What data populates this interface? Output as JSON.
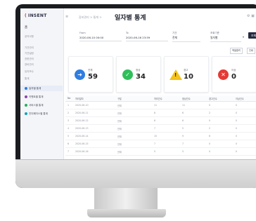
{
  "brand": {
    "mark": "(",
    "name": "INSENT"
  },
  "sidebar": {
    "home": "홈",
    "items": [
      "공지사항",
      "기관관리",
      "기관설정",
      "권한관리",
      "장비관리",
      "유지보수",
      "통계"
    ],
    "subitems": [
      {
        "label": "일자별 통계",
        "color": "#2f7de1",
        "active": true
      },
      {
        "label": "이벤트별 통계",
        "color": "#8e44ad",
        "active": false
      },
      {
        "label": "서비스별 통계",
        "color": "#27ae60",
        "active": false
      },
      {
        "label": "인더페이스별 통계",
        "color": "#16a2b8",
        "active": false
      }
    ]
  },
  "header": {
    "breadcrumb": "장비관리 > 통계 >",
    "title": "일자별 통계",
    "right_icons": "⚙ ▣"
  },
  "filter": {
    "from_label": "From",
    "from_value": "2020-06-10 00:00",
    "to_label": "To",
    "to_value": "2020-06-16 23:59",
    "agency_label": "기관",
    "agency_value": "전체",
    "type_label": "조회기준",
    "type_value": "일자별",
    "search_label": "조회"
  },
  "actions": {
    "excel": "엑셀출력",
    "print": "인쇄"
  },
  "colors": {
    "blue": "#2f7de1",
    "green": "#2fbf5a",
    "yellow": "#f4c21a",
    "red": "#e53935",
    "dark": "#262a40"
  },
  "stats": [
    {
      "label": "전체",
      "value": "59",
      "icon": "arrow-right-icon"
    },
    {
      "label": "정상",
      "value": "34",
      "icon": "check-icon"
    },
    {
      "label": "경고",
      "value": "10",
      "icon": "warning-icon"
    },
    {
      "label": "이상",
      "value": "0",
      "icon": "close-icon"
    }
  ],
  "table": {
    "columns": [
      "No",
      "처리일자",
      "구분",
      "처리건수",
      "정상건수",
      "경고건수",
      "이상건수"
    ],
    "rows": [
      [
        "1",
        "2020-06-10",
        "전체",
        "11",
        "11",
        "0",
        "0"
      ],
      [
        "2",
        "2020-06-11",
        "전체",
        "8",
        "6",
        "2",
        "0"
      ],
      [
        "3",
        "2020-06-12",
        "전체",
        "6",
        "6",
        "0",
        "0"
      ],
      [
        "4",
        "2020-06-13",
        "전체",
        "7",
        "5",
        "2",
        "0"
      ],
      [
        "5",
        "2020-06-14",
        "전체",
        "15",
        "9",
        "6",
        "0"
      ],
      [
        "6",
        "2020-06-15",
        "전체",
        "7",
        "7",
        "0",
        "0"
      ],
      [
        "7",
        "2020-06-16",
        "전체",
        "5",
        "5",
        "0",
        "0"
      ]
    ]
  }
}
